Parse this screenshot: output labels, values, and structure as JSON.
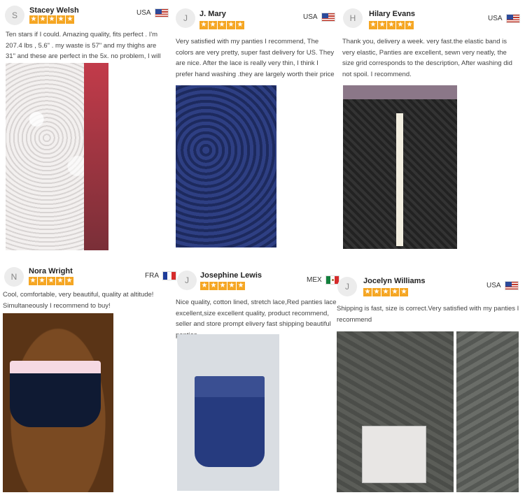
{
  "reviews": [
    {
      "initial": "S",
      "name": "Stacey Welsh",
      "country": "USA",
      "flag": "us",
      "rating": 5,
      "text": "Ten stars if I could. Amazing quality, fits perfect . I'm 207.4 lbs , 5.6\" . my waste is 57\" and my thighs are 31\" and these are perfect in the 5x. no problem, I will get more"
    },
    {
      "initial": "J",
      "name": "J. Mary",
      "country": "USA",
      "flag": "us",
      "rating": 5,
      "text": "Very satisfied with my panties I recommend,  The colors are very pretty, super fast delivery for US. They are nice. After the lace is really very thin, I think I prefer hand washing .they are largely worth their price"
    },
    {
      "initial": "H",
      "name": "Hilary Evans",
      "country": "USA",
      "flag": "us",
      "rating": 5,
      "text": "Thank you, delivery a week. very fast.the elastic band is very elastic, Panties are excellent, sewn very neatly, the size grid corresponds to the description, After washing did not spoil. I recommend."
    },
    {
      "initial": "N",
      "name": "Nora Wright",
      "country": "FRA",
      "flag": "fr",
      "rating": 5,
      "text": "Cool, comfortable, very beautiful, quality at altitude! Simultaneously I recommend to buy!"
    },
    {
      "initial": "J",
      "name": "Josephine Lewis",
      "country": "MEX",
      "flag": "mx",
      "rating": 5,
      "text": "Nice quality, cotton lined, stretch lace,Red panties lace excellent,size excellent quality, product recommend, seller and store prompt elivery fast shipping beautiful panties"
    },
    {
      "initial": "J",
      "name": "Jocelyn Williams",
      "country": "USA",
      "flag": "us",
      "rating": 5,
      "text": "Shipping is fast, size is correct.Very satisfied with my panties I recommend"
    }
  ],
  "star_glyph": "★",
  "star_color": "#f5a623"
}
